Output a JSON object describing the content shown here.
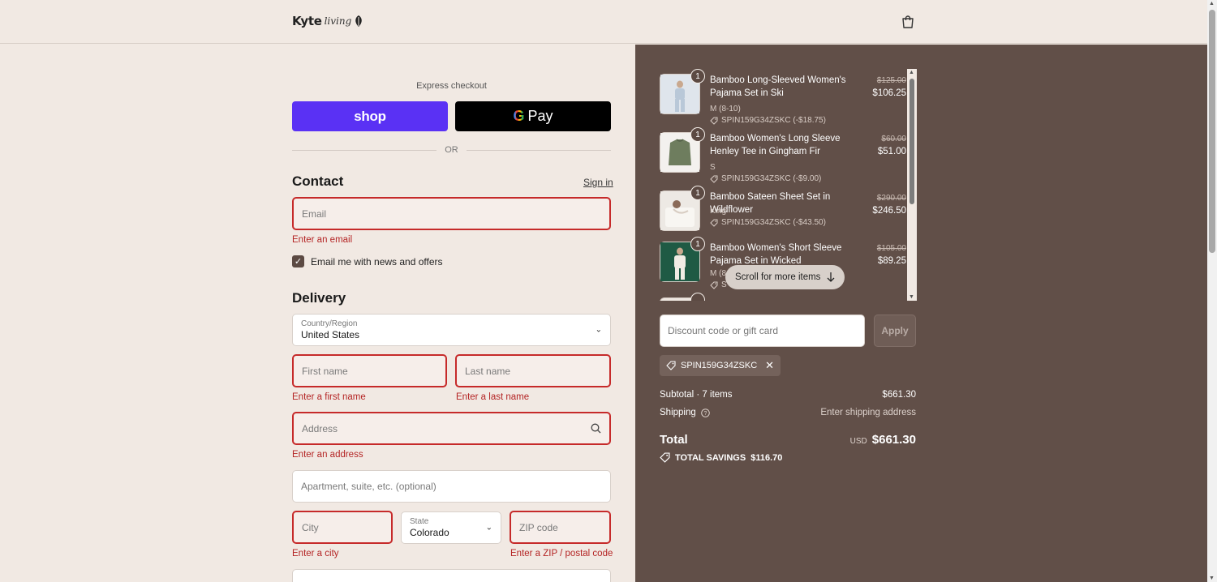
{
  "header": {
    "brand": "Kyte",
    "brand_script": "living"
  },
  "express": {
    "label": "Express checkout",
    "shop_label": "shop",
    "gpay_g": "G",
    "gpay_label": "Pay",
    "or_label": "OR"
  },
  "contact": {
    "title": "Contact",
    "sign_in": "Sign in",
    "email_placeholder": "Email",
    "email_error": "Enter an email",
    "newsletter_label": "Email me with news and offers",
    "newsletter_checked": true
  },
  "delivery": {
    "title": "Delivery",
    "country_label": "Country/Region",
    "country_value": "United States",
    "first_name_placeholder": "First name",
    "first_name_error": "Enter a first name",
    "last_name_placeholder": "Last name",
    "last_name_error": "Enter a last name",
    "address_placeholder": "Address",
    "address_error": "Enter an address",
    "apartment_placeholder": "Apartment, suite, etc. (optional)",
    "city_placeholder": "City",
    "city_error": "Enter a city",
    "state_label": "State",
    "state_value": "Colorado",
    "zip_placeholder": "ZIP code",
    "zip_error": "Enter a ZIP / postal code"
  },
  "order": {
    "items": [
      {
        "qty": "1",
        "name": "Bamboo Long-Sleeved Women's Pajama Set in Ski",
        "variant": "M (8-10)",
        "discount": "SPIN159G34ZSKC (-$18.75)",
        "old_price": "$125.00",
        "price": "$106.25"
      },
      {
        "qty": "1",
        "name": "Bamboo Women's Long Sleeve Henley Tee in Gingham Fir",
        "variant": "S",
        "discount": "SPIN159G34ZSKC (-$9.00)",
        "old_price": "$60.00",
        "price": "$51.00"
      },
      {
        "qty": "1",
        "name": "Bamboo Sateen Sheet Set in Wildflower",
        "variant": "King",
        "discount": "SPIN159G34ZSKC (-$43.50)",
        "old_price": "$290.00",
        "price": "$246.50"
      },
      {
        "qty": "1",
        "name": "Bamboo Women's Short Sleeve Pajama Set in Wicked",
        "variant": "M (8",
        "discount": "S",
        "old_price": "$105.00",
        "price": "$89.25"
      }
    ],
    "scroll_more": "Scroll for more items",
    "discount_placeholder": "Discount code or gift card",
    "apply_label": "Apply",
    "applied_code": "SPIN159G34ZSKC",
    "subtotal_label": "Subtotal · 7 items",
    "subtotal_value": "$661.30",
    "shipping_label": "Shipping",
    "shipping_value": "Enter shipping address",
    "total_label": "Total",
    "currency": "USD",
    "total_value": "$661.30",
    "savings_label": "TOTAL SAVINGS",
    "savings_value": "$116.70"
  },
  "colors": {
    "shop_pay": "#5a31f4",
    "panel": "#614f48",
    "error": "#c62a2a"
  }
}
